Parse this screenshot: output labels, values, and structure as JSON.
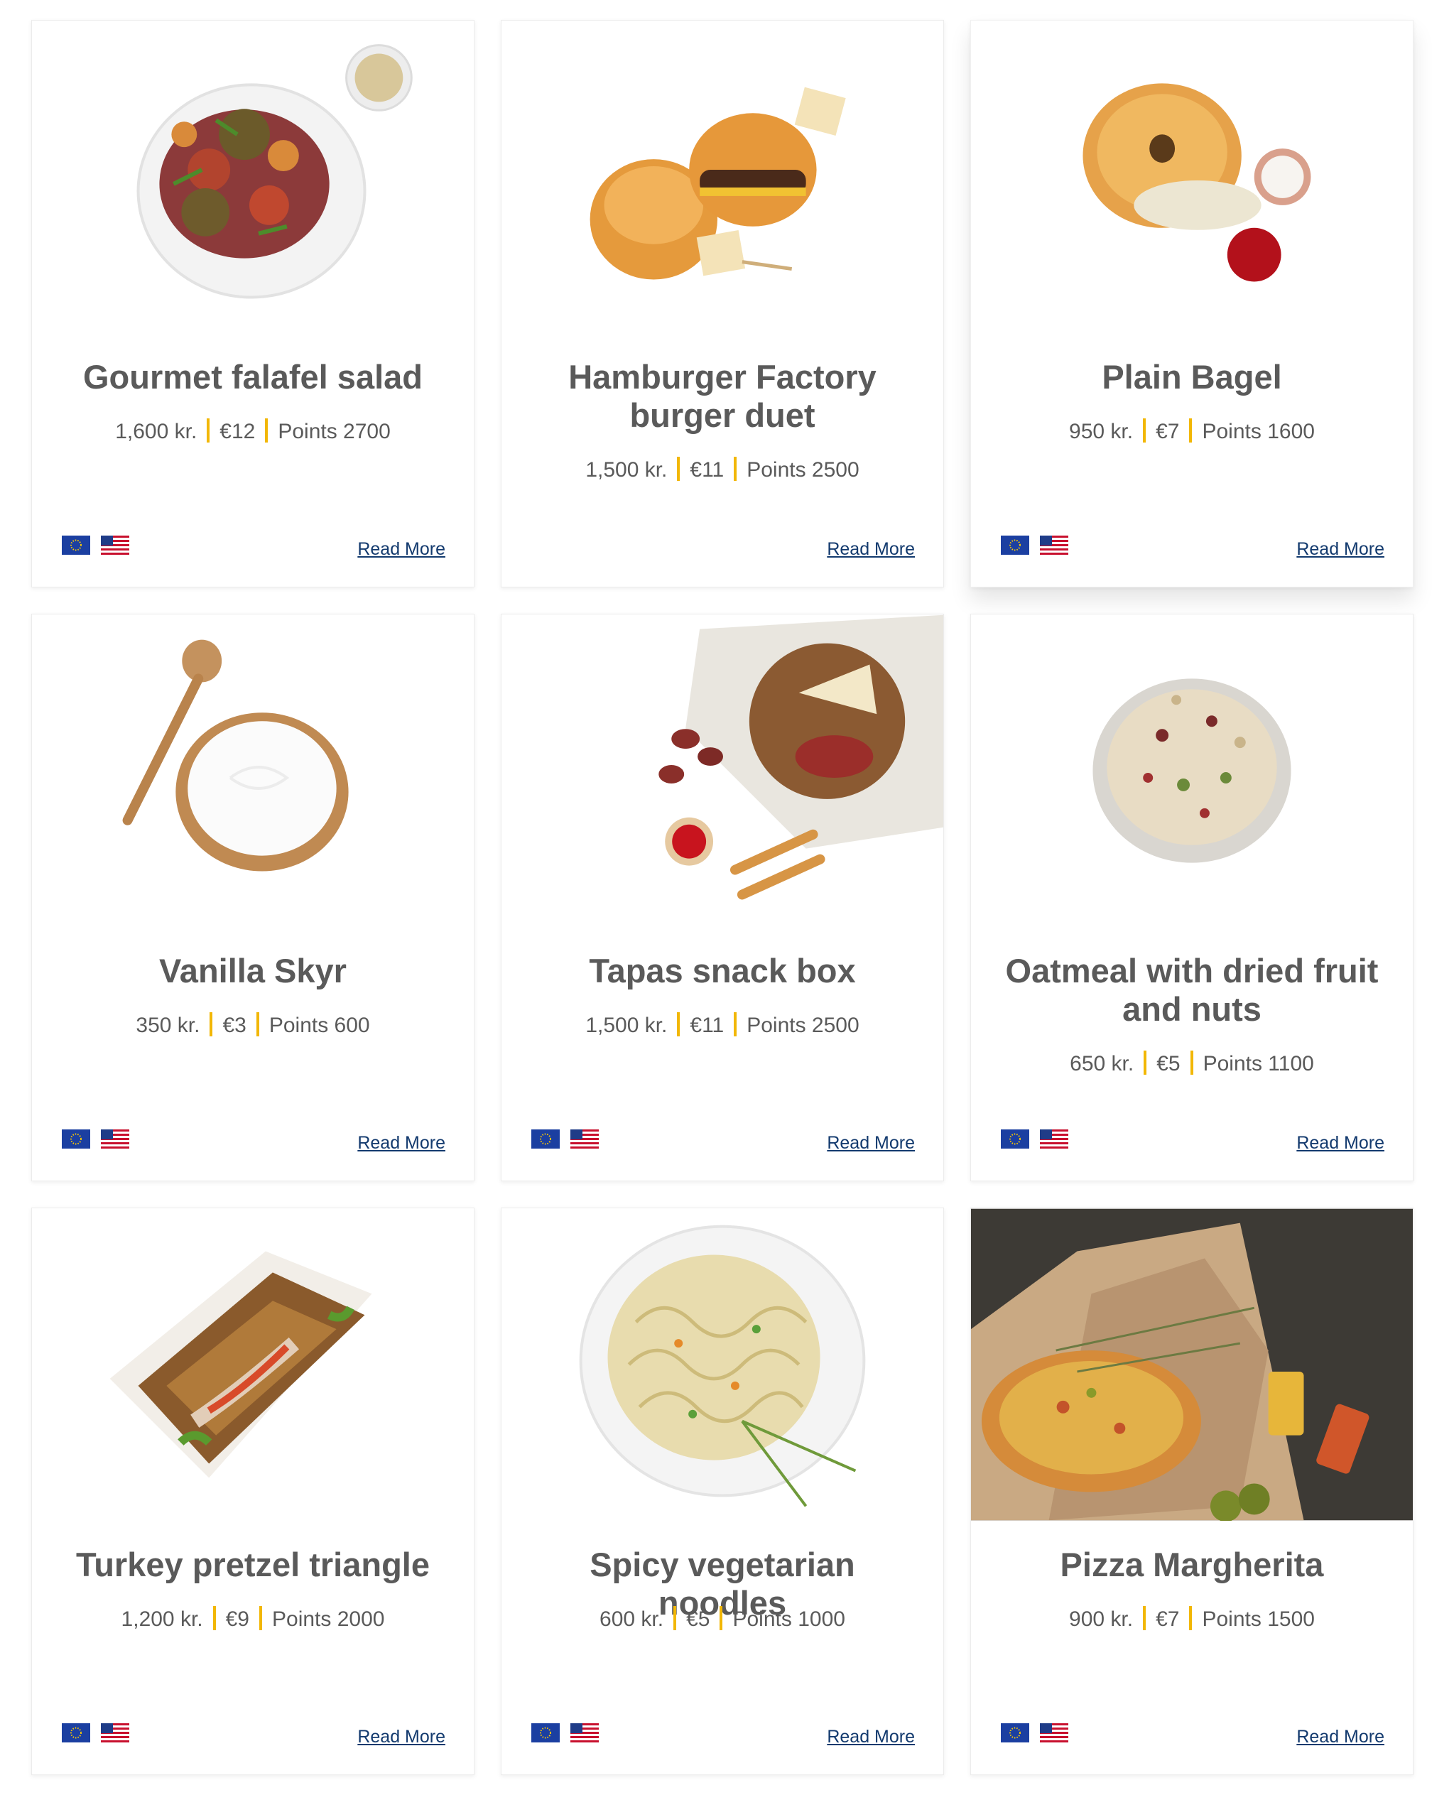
{
  "cards": [
    {
      "title": "Gourmet falafel salad",
      "price_isk": "1,600 kr.",
      "price_eur": "€12",
      "points": "Points 2700",
      "read_more": "Read More",
      "image": "falafel-salad-image"
    },
    {
      "title": "Hamburger Factory burger duet",
      "price_isk": "1,500 kr.",
      "price_eur": "€11",
      "points": "Points 2500",
      "read_more": "Read More",
      "image": "burger-duet-image"
    },
    {
      "title": "Plain Bagel",
      "price_isk": "950 kr.",
      "price_eur": "€7",
      "points": "Points 1600",
      "read_more": "Read More",
      "image": "bagel-image"
    },
    {
      "title": "Vanilla Skyr",
      "price_isk": "350 kr.",
      "price_eur": "€3",
      "points": "Points 600",
      "read_more": "Read More",
      "image": "skyr-image"
    },
    {
      "title": "Tapas snack box",
      "price_isk": "1,500 kr.",
      "price_eur": "€11",
      "points": "Points 2500",
      "read_more": "Read More",
      "image": "tapas-image"
    },
    {
      "title": "Oatmeal with dried fruit and nuts",
      "price_isk": "650 kr.",
      "price_eur": "€5",
      "points": "Points 1100",
      "read_more": "Read More",
      "image": "oatmeal-image"
    },
    {
      "title": "Turkey pretzel triangle",
      "price_isk": "1,200 kr.",
      "price_eur": "€9",
      "points": "Points 2000",
      "read_more": "Read More",
      "image": "pretzel-sandwich-image"
    },
    {
      "title": "Spicy vegetarian noodles",
      "price_isk": "600 kr.",
      "price_eur": "€5",
      "points": "Points 1000",
      "read_more": "Read More",
      "image": "noodles-image"
    },
    {
      "title": "Pizza Margherita",
      "price_isk": "900 kr.",
      "price_eur": "€7",
      "points": "Points 1500",
      "read_more": "Read More",
      "image": "pizza-image"
    }
  ],
  "flags": [
    "eu-flag-icon",
    "us-flag-icon"
  ],
  "colors": {
    "separator": "#f2b705",
    "link": "#133a6e",
    "title": "#5a5a5a"
  }
}
